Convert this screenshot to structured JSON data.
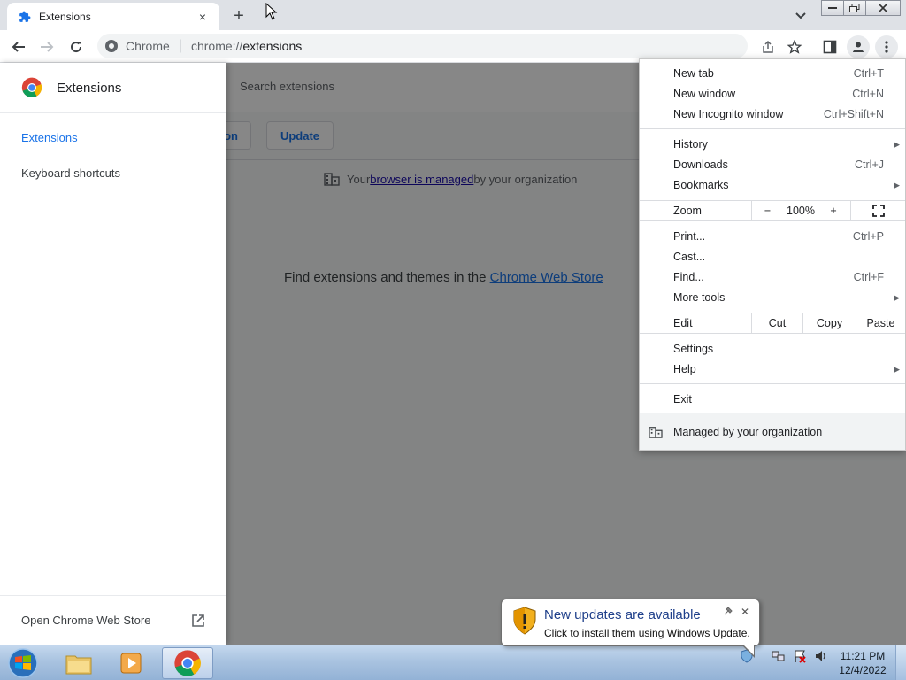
{
  "browser": {
    "tab": {
      "title": "Extensions",
      "close": "×"
    },
    "new_tab_glyph": "+",
    "omnibox": {
      "site_label": "Chrome",
      "separator": "|",
      "url_scheme": "chrome://",
      "url_host": "extensions"
    }
  },
  "page": {
    "sidebar": {
      "title": "Extensions",
      "items": [
        {
          "label": "Extensions",
          "active": true
        },
        {
          "label": "Keyboard shortcuts",
          "active": false
        }
      ],
      "footer": "Open Chrome Web Store"
    },
    "search_placeholder": "Search extensions",
    "buttons": {
      "load_partial": "on",
      "update": "Update"
    },
    "managed": {
      "prefix": "Your ",
      "link": "browser is managed",
      "suffix": " by your organization"
    },
    "store": {
      "prefix": "Find extensions and themes in the ",
      "link": "Chrome Web Store"
    }
  },
  "menu": {
    "new_tab": {
      "label": "New tab",
      "acc": "Ctrl+T"
    },
    "new_window": {
      "label": "New window",
      "acc": "Ctrl+N"
    },
    "incognito": {
      "label": "New Incognito window",
      "acc": "Ctrl+Shift+N"
    },
    "history": {
      "label": "History"
    },
    "downloads": {
      "label": "Downloads",
      "acc": "Ctrl+J"
    },
    "bookmarks": {
      "label": "Bookmarks"
    },
    "zoom": {
      "label": "Zoom",
      "minus": "−",
      "value": "100%",
      "plus": "+"
    },
    "print": {
      "label": "Print...",
      "acc": "Ctrl+P"
    },
    "cast": {
      "label": "Cast..."
    },
    "find": {
      "label": "Find...",
      "acc": "Ctrl+F"
    },
    "more_tools": {
      "label": "More tools"
    },
    "edit": {
      "label": "Edit",
      "cut": "Cut",
      "copy": "Copy",
      "paste": "Paste"
    },
    "settings": {
      "label": "Settings"
    },
    "help": {
      "label": "Help"
    },
    "exit": {
      "label": "Exit"
    },
    "managed": {
      "label": "Managed by your organization"
    },
    "submenu_arrow": "▶"
  },
  "notification": {
    "title": "New updates are available",
    "message": "Click to install them using Windows Update.",
    "close": "✕"
  },
  "taskbar": {
    "clock_time": "11:21 PM",
    "clock_date": "12/4/2022"
  },
  "colors": {
    "accent": "#1a73e8",
    "menu_bg": "#ffffff",
    "taskbar": "#a9c3e0"
  }
}
